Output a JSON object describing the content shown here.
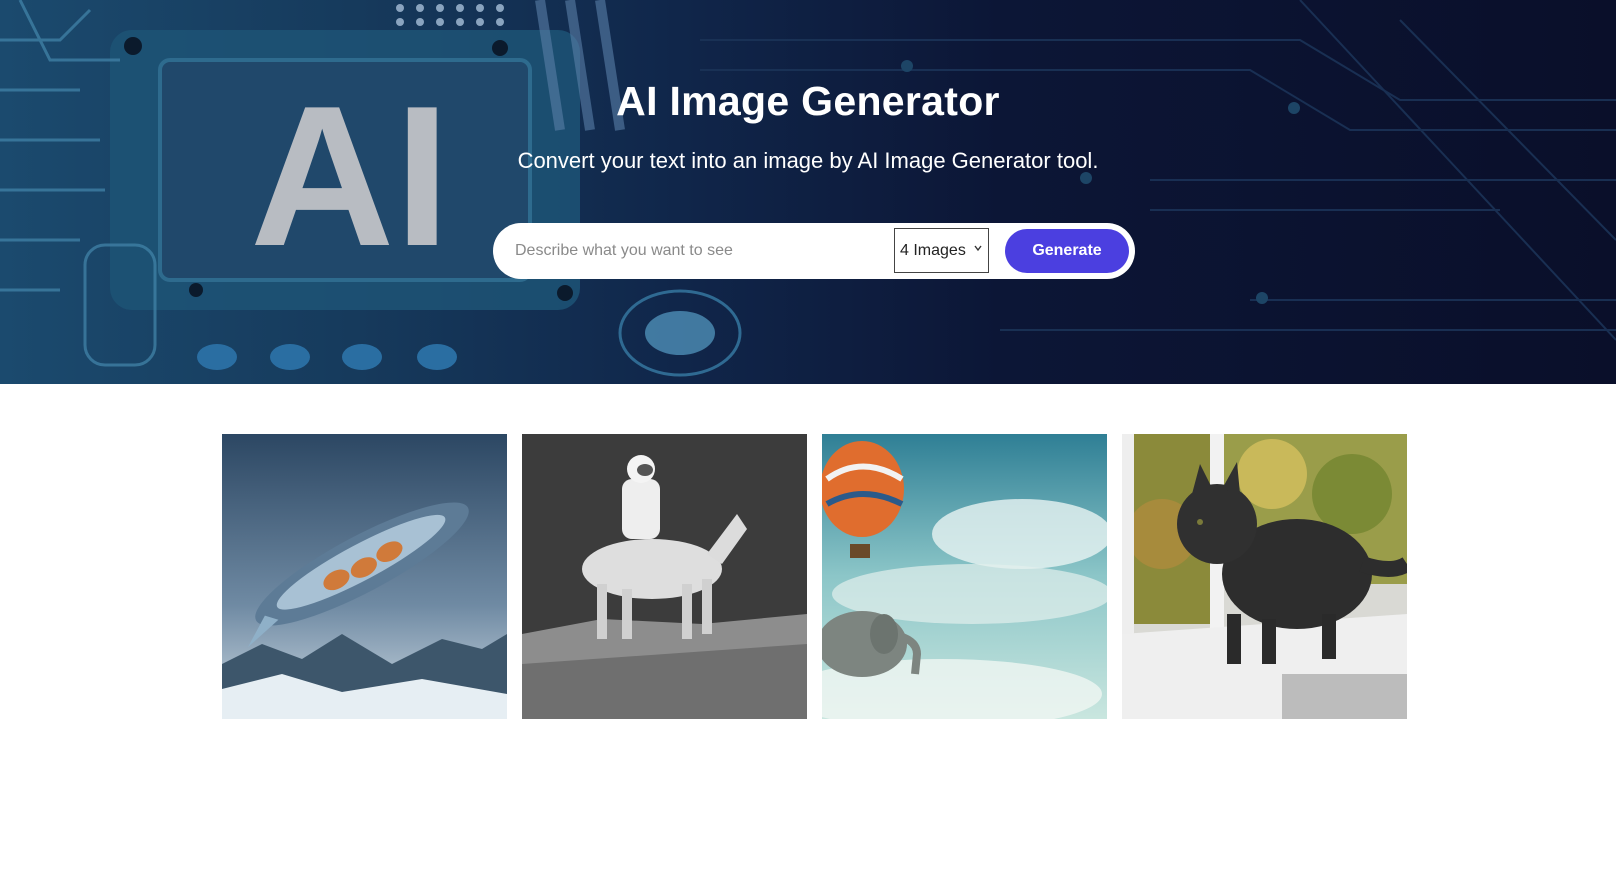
{
  "hero": {
    "title": "AI Image Generator",
    "subtitle": "Convert your text into an image by AI Image Generator tool.",
    "background_image": "circuit-board-ai-chip",
    "background_text": "AI"
  },
  "search": {
    "placeholder": "Describe what you want to see",
    "value": "",
    "image_count": "4 Images",
    "generate_label": "Generate"
  },
  "colors": {
    "accent": "#4b3fe0",
    "hero_dark": "#0a0f2a"
  },
  "gallery": [
    {
      "subject": "futuristic spaceship over icy planet"
    },
    {
      "subject": "astronaut riding a horse on the moon"
    },
    {
      "subject": "elephant with hot air balloon in sky"
    },
    {
      "subject": "black cat on window sill"
    }
  ]
}
